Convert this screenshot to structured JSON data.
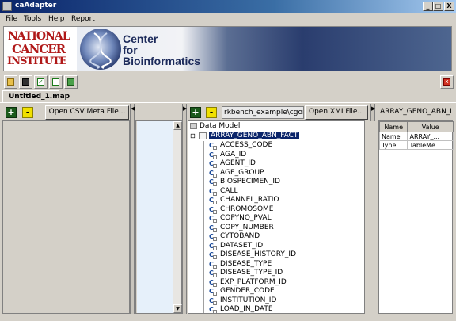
{
  "window": {
    "title": "caAdapter",
    "min_label": "_",
    "max_label": "□",
    "close_label": "X"
  },
  "menu": [
    "File",
    "Tools",
    "Help",
    "Report"
  ],
  "banner": {
    "nci_line1": "NATIONAL",
    "nci_line2": "CANCER",
    "nci_line3": "INSTITUTE",
    "center_line1": "Center",
    "center_line2": "for",
    "center_line3": "Bioinformatics"
  },
  "toolbar": {
    "icons": [
      "open-folder-icon",
      "save-icon",
      "validate-icon",
      "new-document-icon",
      "generate-icon",
      "close-tab-icon"
    ]
  },
  "tabs": [
    {
      "label": "Untitled_1.map"
    }
  ],
  "source_pane": {
    "add": "+",
    "remove": "-",
    "open_button": "Open CSV Meta File..."
  },
  "target_pane": {
    "add": "+",
    "remove": "-",
    "path": "rkbench_example\\cgom_",
    "open_button": "Open XMI File...",
    "tree_root": "Data Model",
    "selected_node": "ARRAY_GENO_ABN_FACT",
    "fields": [
      "ACCESS_CODE",
      "AGA_ID",
      "AGENT_ID",
      "AGE_GROUP",
      "BIOSPECIMEN_ID",
      "CALL",
      "CHANNEL_RATIO",
      "CHROMOSOME",
      "COPYNO_PVAL",
      "COPY_NUMBER",
      "CYTOBAND",
      "DATASET_ID",
      "DISEASE_HISTORY_ID",
      "DISEASE_TYPE",
      "DISEASE_TYPE_ID",
      "EXP_PLATFORM_ID",
      "GENDER_CODE",
      "INSTITUTION_ID",
      "LOAD_IN_DATE"
    ]
  },
  "properties": {
    "header": "ARRAY_GENO_ABN_F",
    "columns": [
      "Name",
      "Value"
    ],
    "rows": [
      {
        "name": "Name",
        "value": "ARRAY_..."
      },
      {
        "name": "Type",
        "value": "TableMe..."
      }
    ]
  },
  "colors": {
    "selection": "#0a246a",
    "add_button": "#1b5a1b",
    "nci_red": "#b01818",
    "banner_navy": "#1c2a5a"
  }
}
